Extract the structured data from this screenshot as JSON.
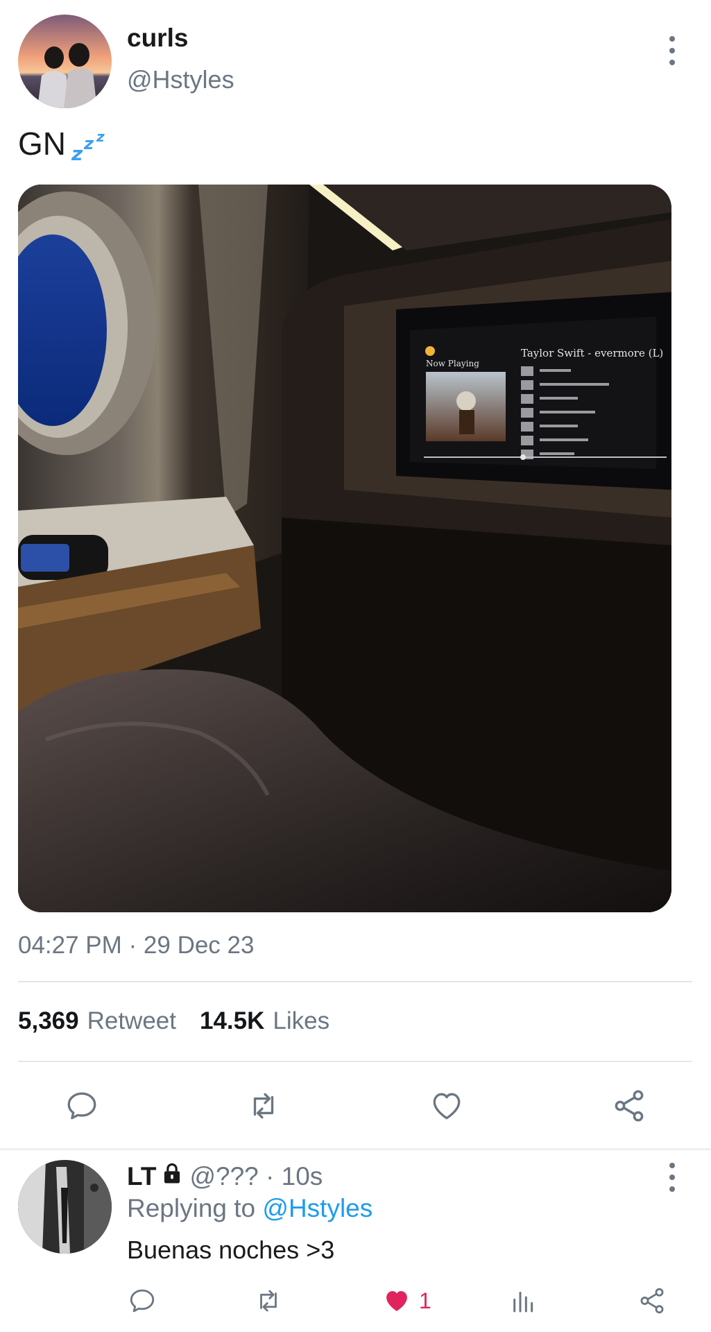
{
  "tweet": {
    "display_name": "curls",
    "handle": "@Hstyles",
    "text": "GN",
    "emoji_icon": "zzz-icon",
    "timestamp": "04:27 PM · 29 Dec 23",
    "stats": {
      "retweets_count": "5,369",
      "retweets_label": "Retweet",
      "likes_count": "14.5K",
      "likes_label": "Likes"
    },
    "photo_screen": {
      "now_playing": "Now Playing",
      "album_title": "Taylor Swift - evermore (L)"
    },
    "actions": [
      "reply-icon",
      "retweet-icon",
      "heart-icon",
      "share-icon"
    ]
  },
  "reply": {
    "display_name": "LT",
    "meta": "@??? · 10s",
    "replying_prefix": "Replying to",
    "replying_to": "@Hstyles",
    "text": "Buenas noches >3",
    "like_count": "1",
    "liked": true,
    "actions": [
      "reply-icon",
      "retweet-icon",
      "heart-icon",
      "analytics-icon",
      "share-icon"
    ]
  },
  "colors": {
    "accent": "#1d9bf0",
    "like": "#e0245e",
    "secondary_text": "#6b7682"
  }
}
